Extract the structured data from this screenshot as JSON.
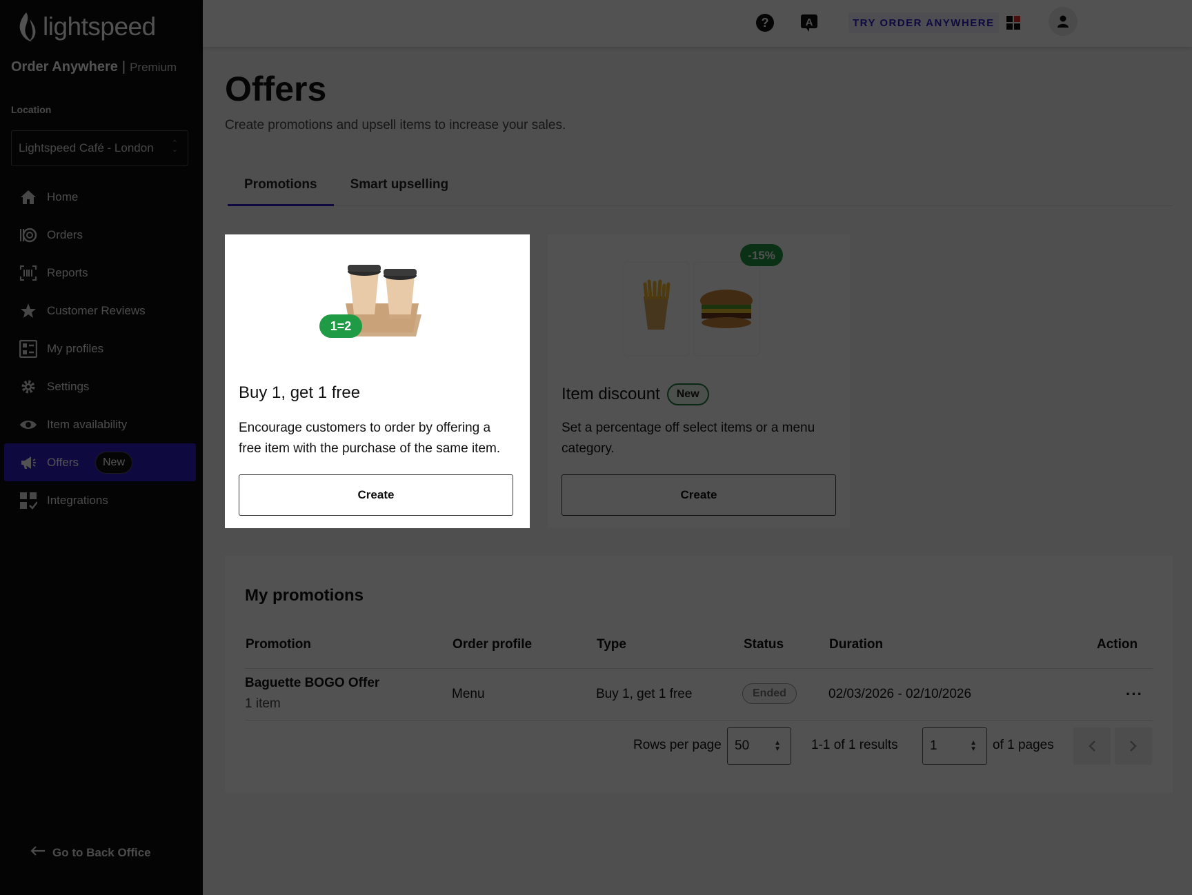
{
  "sidebar": {
    "logo_text": "lightspeed",
    "app_name": "Order Anywhere",
    "separator": "|",
    "tier": "Premium",
    "location_label": "Location",
    "location_value": "Lightspeed Café - London",
    "items": [
      {
        "label": "Home",
        "icon": "home-icon"
      },
      {
        "label": "Orders",
        "icon": "orders-icon"
      },
      {
        "label": "Reports",
        "icon": "reports-icon"
      },
      {
        "label": "Customer Reviews",
        "icon": "star-icon"
      },
      {
        "label": "My profiles",
        "icon": "profiles-icon"
      },
      {
        "label": "Settings",
        "icon": "gear-icon"
      },
      {
        "label": "Item availability",
        "icon": "eye-icon"
      },
      {
        "label": "Offers",
        "icon": "megaphone-icon",
        "badge": "New",
        "active": true
      },
      {
        "label": "Integrations",
        "icon": "integrations-icon"
      }
    ],
    "back_office": "Go to Back Office"
  },
  "header": {
    "try_label": "TRY ORDER ANYWHERE",
    "icons": [
      "help-icon",
      "translate-icon",
      "apps-icon",
      "user-icon"
    ]
  },
  "main": {
    "title": "Offers",
    "subtitle": "Create promotions and upsell items to increase your sales.",
    "tabs": [
      {
        "label": "Promotions",
        "active": true
      },
      {
        "label": "Smart upselling"
      }
    ],
    "cards": [
      {
        "title": "Buy 1, get 1 free",
        "badge_image": "1=2",
        "description": "Encourage customers to order by offering a free item with the purchase of the same item.",
        "button": "Create"
      },
      {
        "title": "Item discount",
        "pill": "New",
        "badge_image": "-15%",
        "description": "Set a percentage off select items or a menu category.",
        "button": "Create"
      }
    ]
  },
  "promotions": {
    "title": "My promotions",
    "columns": [
      "Promotion",
      "Order profile",
      "Type",
      "Status",
      "Duration",
      "Action"
    ],
    "rows": [
      {
        "name": "Baguette BOGO Offer",
        "sub": "1 item",
        "profile": "Menu",
        "type": "Buy 1, get 1 free",
        "status": "Ended",
        "duration": "02/03/2026 - 02/10/2026",
        "action": "···"
      }
    ],
    "pagination": {
      "rows_label": "Rows per page",
      "rows_value": "50",
      "results": "1-1 of 1 results",
      "page_value": "1",
      "of_pages": "of 1 pages"
    }
  },
  "colors": {
    "accent": "#2d21c4",
    "sidebar_bg": "#0d0d0d",
    "success": "#1f7a3b",
    "overlay": "rgba(0,0,0,0.68)"
  }
}
